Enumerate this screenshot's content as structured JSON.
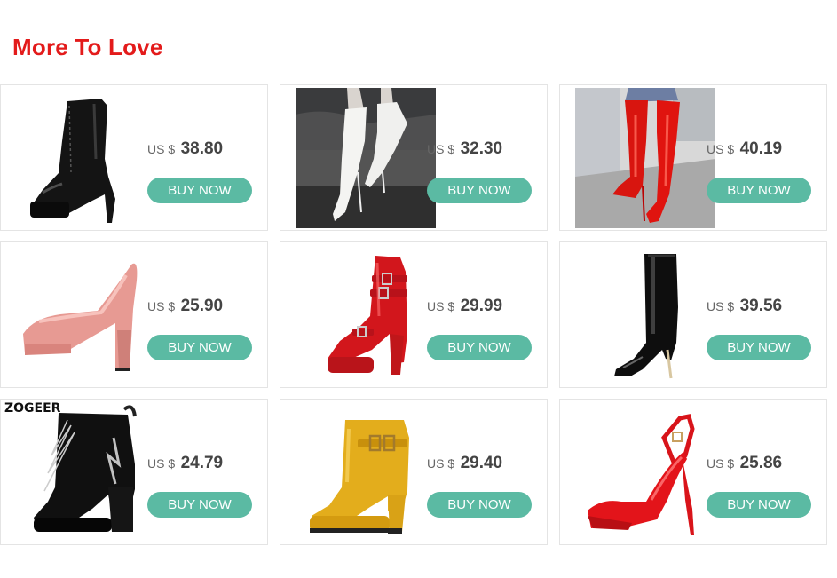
{
  "section": {
    "title": "More To Love"
  },
  "products": [
    {
      "currency": "US $",
      "price": "38.80",
      "buy_label": "BUY NOW",
      "image": "black-patent-lace-up-platform-ankle-boot"
    },
    {
      "currency": "US $",
      "price": "32.30",
      "buy_label": "BUY NOW",
      "image": "white-over-the-knee-stiletto-boot"
    },
    {
      "currency": "US $",
      "price": "40.19",
      "buy_label": "BUY NOW",
      "image": "red-patent-over-the-knee-boot"
    },
    {
      "currency": "US $",
      "price": "25.90",
      "buy_label": "BUY NOW",
      "image": "pink-platform-pump"
    },
    {
      "currency": "US $",
      "price": "29.99",
      "buy_label": "BUY NOW",
      "image": "red-buckle-platform-ankle-boot"
    },
    {
      "currency": "US $",
      "price": "39.56",
      "buy_label": "BUY NOW",
      "image": "black-patent-knee-high-stiletto-boot"
    },
    {
      "currency": "US $",
      "price": "24.79",
      "buy_label": "BUY NOW",
      "image": "black-patent-block-heel-ankle-boot",
      "brand": "ZOGEER"
    },
    {
      "currency": "US $",
      "price": "29.40",
      "buy_label": "BUY NOW",
      "image": "yellow-buckle-platform-ankle-boot"
    },
    {
      "currency": "US $",
      "price": "25.86",
      "buy_label": "BUY NOW",
      "image": "red-peep-toe-slingback-heel"
    }
  ]
}
